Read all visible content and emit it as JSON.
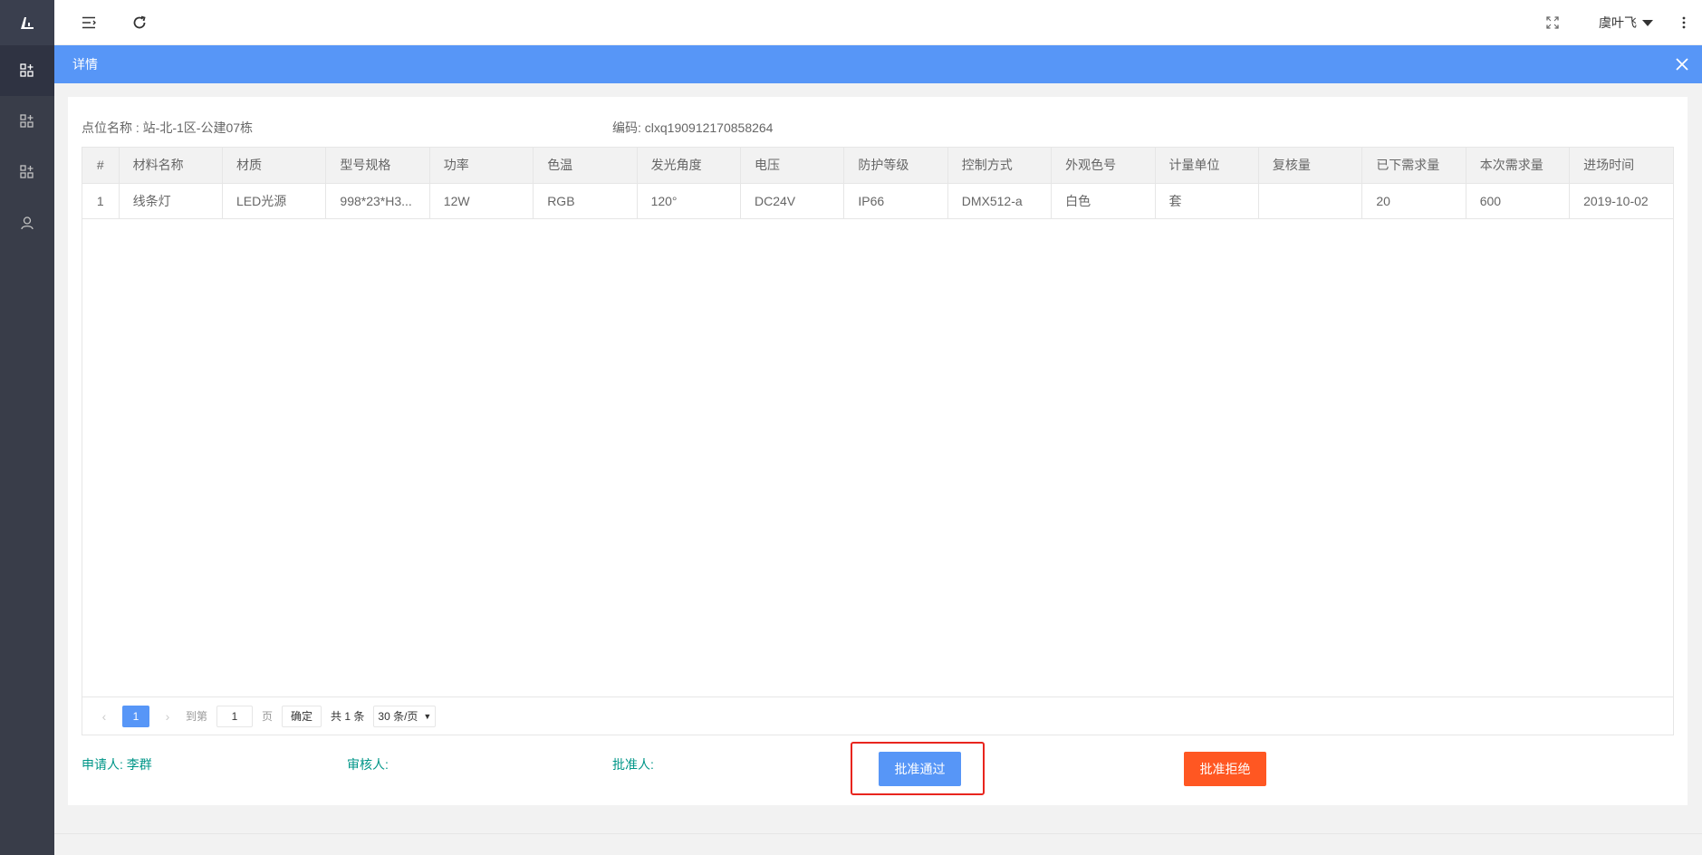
{
  "header": {
    "user_name": "虞叶飞"
  },
  "dialog": {
    "title": "详情"
  },
  "info": {
    "location_label": "点位名称 : 站-北-1区-公建07栋",
    "code_label": "编码: clxq190912170858264"
  },
  "table": {
    "headers": [
      "#",
      "材料名称",
      "材质",
      "型号规格",
      "功率",
      "色温",
      "发光角度",
      "电压",
      "防护等级",
      "控制方式",
      "外观色号",
      "计量单位",
      "复核量",
      "已下需求量",
      "本次需求量",
      "进场时间"
    ],
    "rows": [
      [
        "1",
        "线条灯",
        "LED光源",
        "998*23*H3...",
        "12W",
        "RGB",
        "120°",
        "DC24V",
        "IP66",
        "DMX512-a",
        "白色",
        "套",
        "",
        "20",
        "600",
        "2019-10-02"
      ]
    ]
  },
  "pager": {
    "current_page": "1",
    "goto_label": "到第",
    "page_input": "1",
    "page_unit": "页",
    "confirm": "确定",
    "total": "共 1 条",
    "page_size": "30 条/页"
  },
  "footer": {
    "applicant": "申请人: 李群",
    "reviewer": "审核人:",
    "approver": "批准人:",
    "approve_button": "批准通过",
    "reject_button": "批准拒绝"
  },
  "colors": {
    "sidebar": "#393d49",
    "title_bar": "#5796f7",
    "approve": "#5796f7",
    "reject": "#ff5722",
    "label_green": "#009688",
    "highlight": "#e8251e"
  }
}
